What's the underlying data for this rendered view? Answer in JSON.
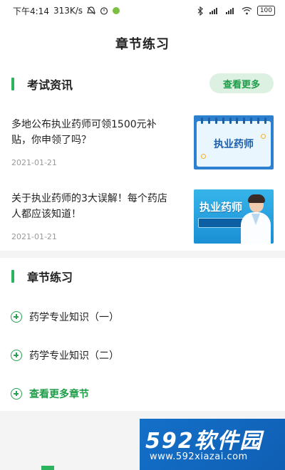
{
  "status_bar": {
    "time": "下午4:14",
    "speed": "313K/s",
    "battery": "100"
  },
  "header": {
    "title": "章节练习"
  },
  "news": {
    "title": "考试资讯",
    "more_label": "查看更多",
    "items": [
      {
        "title": "多地公布执业药师可领1500元补贴，你申领了吗？",
        "date": "2021-01-21",
        "thumb_text": "执业药师"
      },
      {
        "title": "关于执业药师的3大误解！每个药店人都应该知道！",
        "date": "2021-01-21",
        "thumb_text": "执业药师"
      }
    ]
  },
  "practice": {
    "title": "章节练习",
    "items": [
      {
        "label": "药学专业知识（一）"
      },
      {
        "label": "药学专业知识（二）"
      }
    ],
    "more_label": "查看更多章节"
  },
  "watermark": {
    "brand": "592软件园",
    "url": "www.592xiazai.com"
  },
  "colors": {
    "accent": "#2bb45d",
    "accent_text": "#1e9d48",
    "more_bg": "#ddf1e2"
  }
}
